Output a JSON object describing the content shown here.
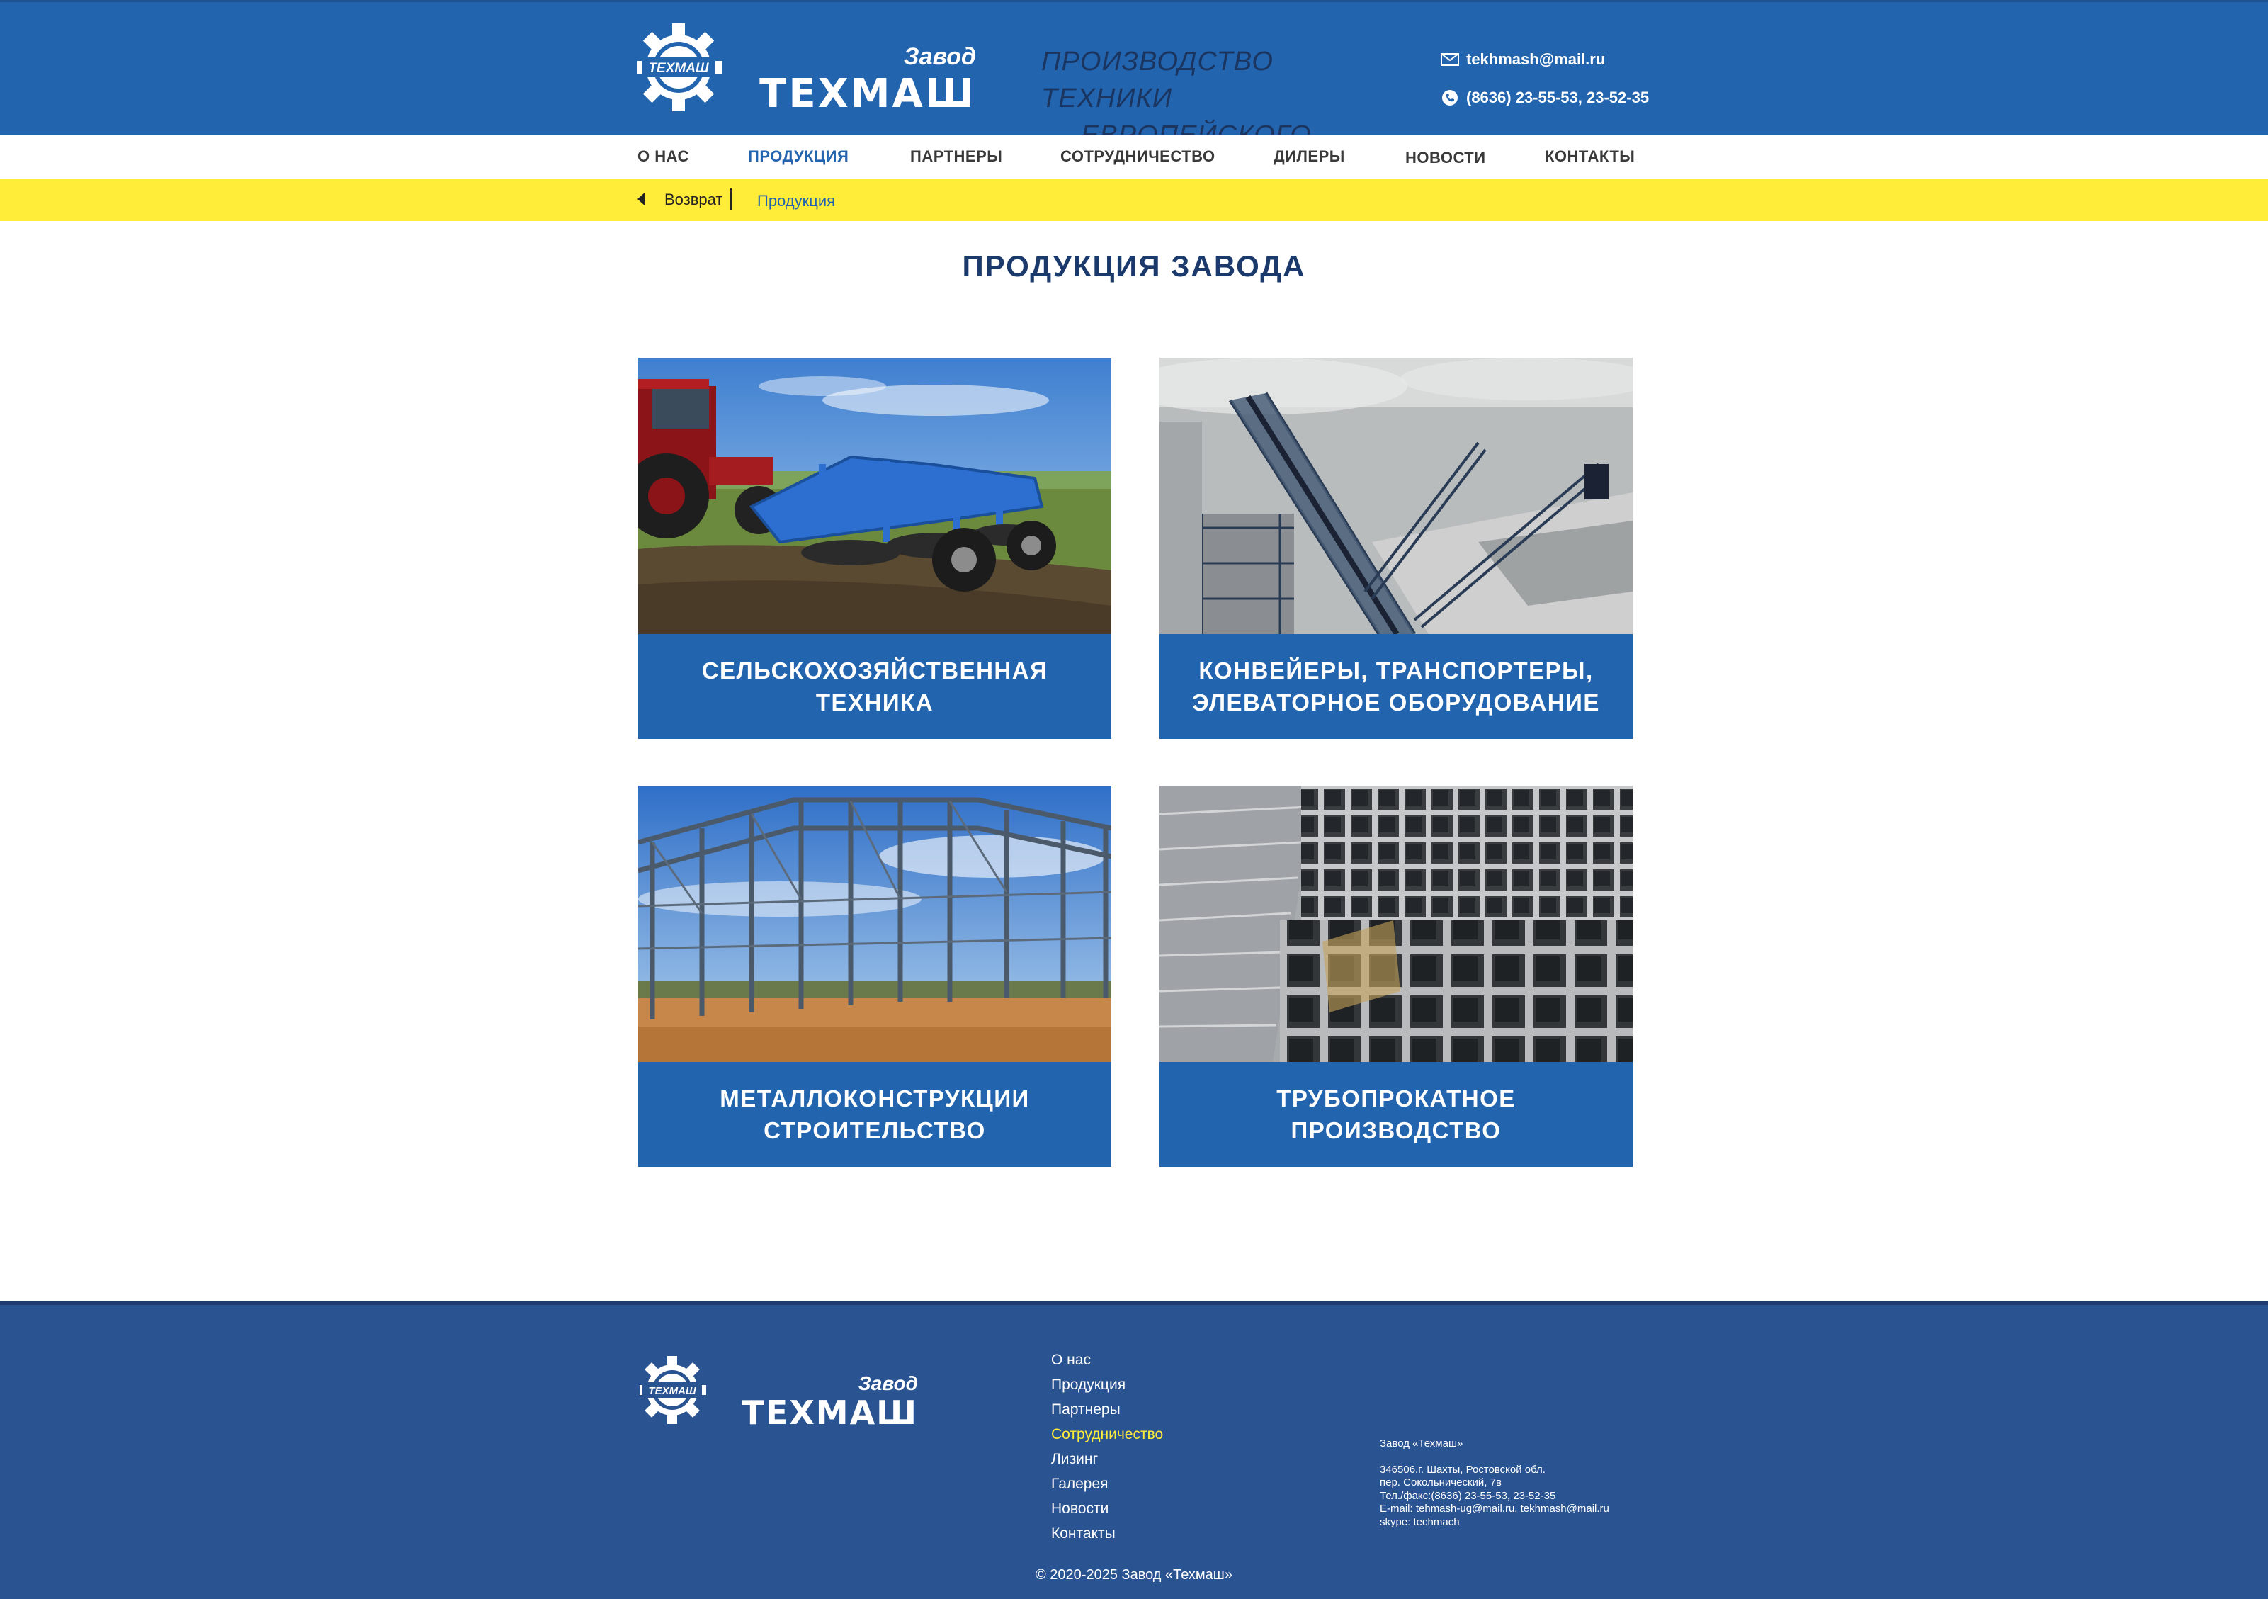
{
  "header": {
    "logo_badge": "ТЕХМАШ",
    "logo_top": "Завод",
    "logo_main": "ТЕХМАШ",
    "slogan_line1": "ПРОИЗВОДСТВО  ТЕХНИКИ",
    "slogan_line2": "ЕВРОПЕЙСКОГО КАЧЕСТВА",
    "email": "tekhmash@mail.ru",
    "phone": "(8636) 23-55-53, 23-52-35"
  },
  "nav": {
    "items": [
      {
        "label": "О НАС"
      },
      {
        "label": "ПРОДУКЦИЯ"
      },
      {
        "label": "ПАРТНЕРЫ"
      },
      {
        "label": "СОТРУДНИЧЕСТВО"
      },
      {
        "label": "ДИЛЕРЫ"
      },
      {
        "label": "НОВОСТИ"
      },
      {
        "label": "КОНТАКТЫ"
      }
    ],
    "active": "ПРОДУКЦИЯ"
  },
  "breadcrumb": {
    "back": "Возврат",
    "current": "Продукция"
  },
  "main": {
    "title": "ПРОДУКЦИЯ  ЗАВОДА",
    "cards": [
      {
        "line1": "СЕЛЬСКОХОЗЯЙСТВЕННАЯ",
        "line2": "ТЕХНИКА"
      },
      {
        "line1": "КОНВЕЙЕРЫ,  ТРАНСПОРТЕРЫ,",
        "line2": "ЭЛЕВАТОРНОЕ  ОБОРУДОВАНИЕ"
      },
      {
        "line1": "МЕТАЛЛОКОНСТРУКЦИИ",
        "line2": "СТРОИТЕЛЬСТВО"
      },
      {
        "line1": "ТРУБОПРОКАТНОЕ",
        "line2": "ПРОИЗВОДСТВО"
      }
    ]
  },
  "footer": {
    "logo_badge": "ТЕХМАШ",
    "logo_top": "Завод",
    "logo_main": "ТЕХМАШ",
    "menu": [
      {
        "label": "О нас"
      },
      {
        "label": "Продукция"
      },
      {
        "label": "Партнеры"
      },
      {
        "label": "Сотрудничество"
      },
      {
        "label": "Лизинг"
      },
      {
        "label": "Галерея"
      },
      {
        "label": "Новости"
      },
      {
        "label": "Контакты"
      }
    ],
    "menu_highlight": "Сотрудничество",
    "address": {
      "company": "Завод «Техмаш»",
      "line1": "346506.г. Шахты, Ростовской обл.",
      "line2": "пер. Сокольнический, 7в",
      "line3": "Тел./факс:(8636) 23-55-53, 23-52-35",
      "line4": "E-mail: tehmash-ug@mail.ru, tekhmash@mail.ru",
      "line5": "skype: techmach"
    },
    "copyright": "© 2020-2025 Завод «Техмаш»"
  },
  "colors": {
    "primary_blue": "#2264ae",
    "dark_blue": "#1b3a6b",
    "footer_blue": "#2a5392",
    "accent_yellow": "#ffed3a"
  }
}
